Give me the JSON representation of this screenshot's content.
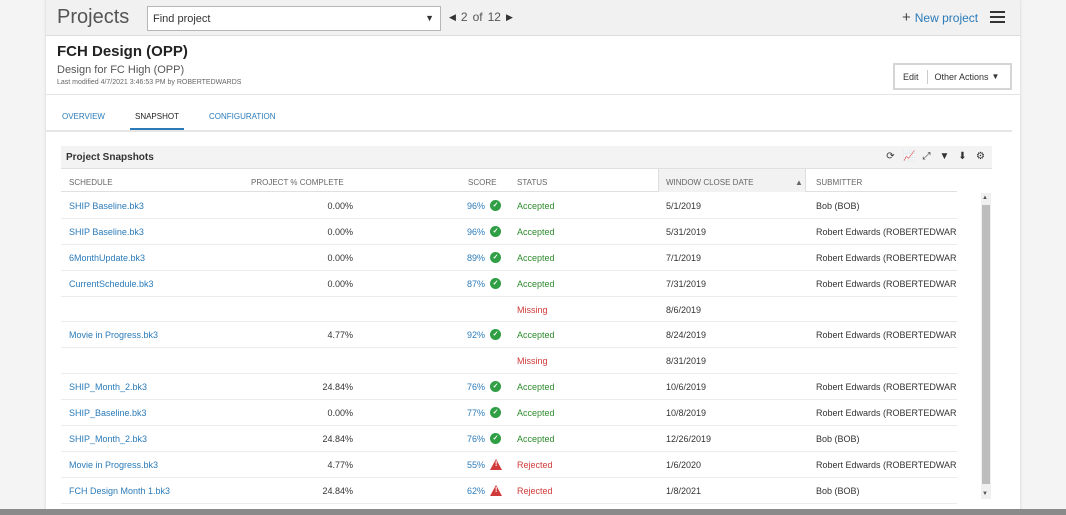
{
  "header": {
    "title": "Projects",
    "find_placeholder": "Find project",
    "pager": {
      "current": "2",
      "of_label": "of",
      "total": "12"
    },
    "new_project": "New project"
  },
  "project": {
    "name": "FCH Design (OPP)",
    "subtitle": "Design for FC High (OPP)",
    "modified": "Last modified 4/7/2021 3:46:53 PM by ROBERTEDWARDS"
  },
  "actions": {
    "edit": "Edit",
    "other": "Other Actions"
  },
  "tabs": [
    {
      "label": "OVERVIEW"
    },
    {
      "label": "SNAPSHOT"
    },
    {
      "label": "CONFIGURATION"
    }
  ],
  "panel": {
    "title": "Project Snapshots",
    "columns": {
      "schedule": "SCHEDULE",
      "pct": "PROJECT % COMPLETE",
      "score": "SCORE",
      "status": "STATUS",
      "window": "WINDOW CLOSE DATE",
      "submitter": "SUBMITTER"
    },
    "rows": [
      {
        "schedule": "SHIP Baseline.bk3",
        "pct": "0.00%",
        "score": "96%",
        "status": "Accepted",
        "date": "5/1/2019",
        "submitter": "Bob (BOB)"
      },
      {
        "schedule": "SHIP Baseline.bk3",
        "pct": "0.00%",
        "score": "96%",
        "status": "Accepted",
        "date": "5/31/2019",
        "submitter": "Robert Edwards (ROBERTEDWARDS)"
      },
      {
        "schedule": "6MonthUpdate.bk3",
        "pct": "0.00%",
        "score": "89%",
        "status": "Accepted",
        "date": "7/1/2019",
        "submitter": "Robert Edwards (ROBERTEDWARDS)"
      },
      {
        "schedule": "CurrentSchedule.bk3",
        "pct": "0.00%",
        "score": "87%",
        "status": "Accepted",
        "date": "7/31/2019",
        "submitter": "Robert Edwards (ROBERTEDWARDS)"
      },
      {
        "schedule": "",
        "pct": "",
        "score": "",
        "status": "Missing",
        "date": "8/6/2019",
        "submitter": ""
      },
      {
        "schedule": "Movie in Progress.bk3",
        "pct": "4.77%",
        "score": "92%",
        "status": "Accepted",
        "date": "8/24/2019",
        "submitter": "Robert Edwards (ROBERTEDWARDS)"
      },
      {
        "schedule": "",
        "pct": "",
        "score": "",
        "status": "Missing",
        "date": "8/31/2019",
        "submitter": ""
      },
      {
        "schedule": "SHIP_Month_2.bk3",
        "pct": "24.84%",
        "score": "76%",
        "status": "Accepted",
        "date": "10/6/2019",
        "submitter": "Robert Edwards (ROBERTEDWARDS)"
      },
      {
        "schedule": "SHIP_Baseline.bk3",
        "pct": "0.00%",
        "score": "77%",
        "status": "Accepted",
        "date": "10/8/2019",
        "submitter": "Robert Edwards (ROBERTEDWARDS)"
      },
      {
        "schedule": "SHIP_Month_2.bk3",
        "pct": "24.84%",
        "score": "76%",
        "status": "Accepted",
        "date": "12/26/2019",
        "submitter": "Bob (BOB)"
      },
      {
        "schedule": "Movie in Progress.bk3",
        "pct": "4.77%",
        "score": "55%",
        "status": "Rejected",
        "date": "1/6/2020",
        "submitter": "Robert Edwards (ROBERTEDWARDS)"
      },
      {
        "schedule": "FCH Design Month 1.bk3",
        "pct": "24.84%",
        "score": "62%",
        "status": "Rejected",
        "date": "1/8/2021",
        "submitter": "Bob (BOB)"
      }
    ]
  }
}
